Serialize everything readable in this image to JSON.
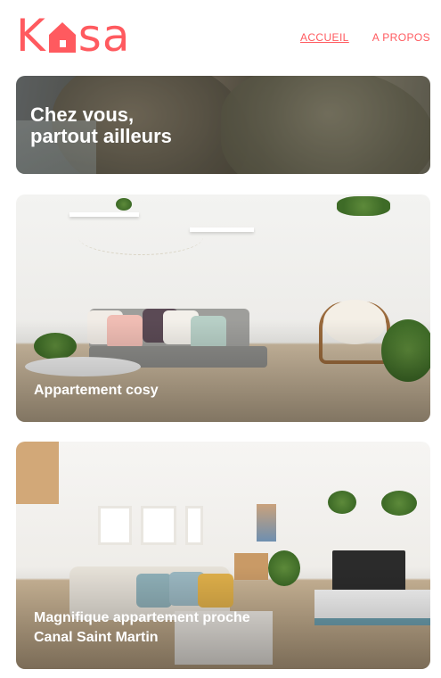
{
  "brand": {
    "logo_left": "K",
    "logo_right": "sa",
    "logo_icon": "house-icon",
    "accent_color": "#ff5a5f"
  },
  "nav": {
    "items": [
      {
        "label": "ACCUEIL",
        "active": true
      },
      {
        "label": "A PROPOS",
        "active": false
      }
    ]
  },
  "hero": {
    "title": "Chez vous,\npartout ailleurs"
  },
  "listings": [
    {
      "title": "Appartement cosy"
    },
    {
      "title": "Magnifique appartement proche\nCanal Saint Martin"
    }
  ]
}
